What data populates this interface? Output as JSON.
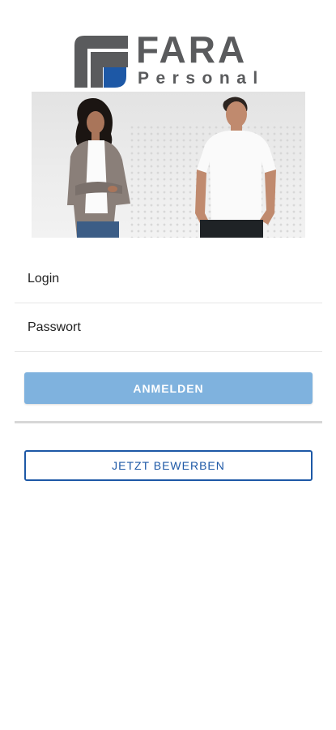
{
  "logo": {
    "brand": "FARA",
    "tagline": "Personal",
    "mark_colors": {
      "dark": "#5a5b5d",
      "accent": "#1d58a6"
    }
  },
  "hero": {
    "image": "hero-photo-woman-and-man"
  },
  "form": {
    "login_placeholder": "Login",
    "password_placeholder": "Passwort",
    "login_button": "ANMELDEN",
    "apply_button": "JETZT BEWERBEN"
  },
  "colors": {
    "primary_button": "#7fb2de",
    "outline_button": "#1d58a6",
    "divider": "#d7d7d7"
  }
}
